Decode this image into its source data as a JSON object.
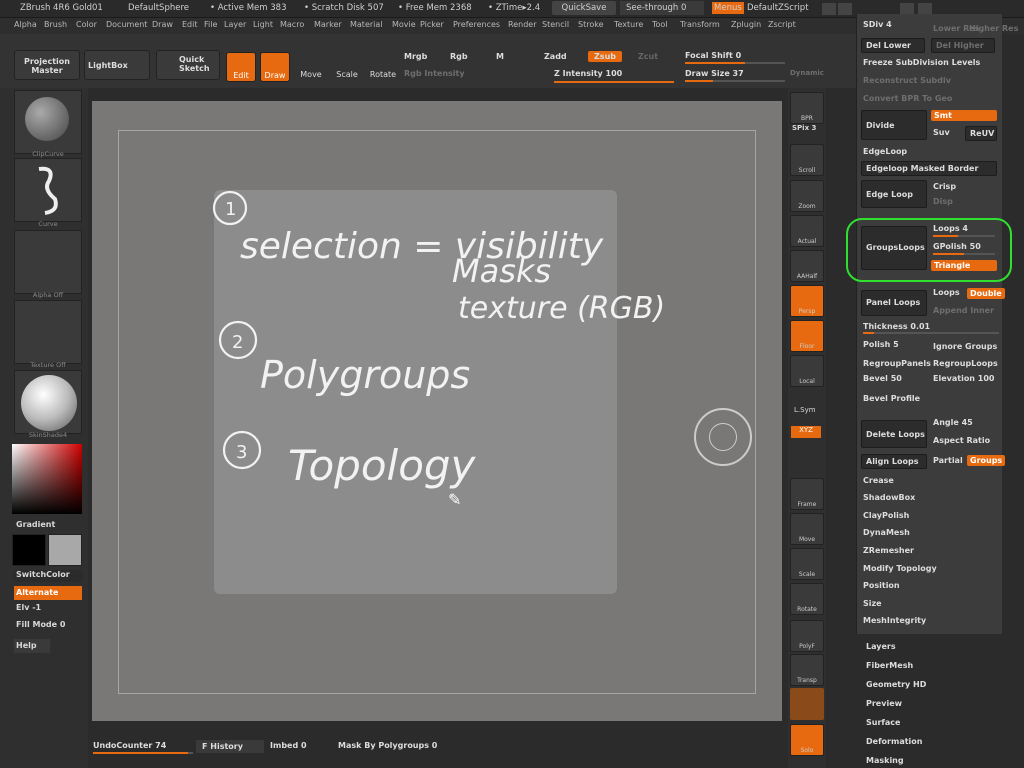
{
  "title_bar": {
    "app": "ZBrush 4R6 Gold01",
    "tool": "DefaultSphere",
    "active_mem": "• Active Mem 383",
    "scratch": "• Scratch Disk 507",
    "free_mem": "• Free Mem 2368",
    "ztime": "• ZTime▸2.4",
    "quicksave": "QuickSave",
    "see_through": "See-through  0",
    "menus": "Menus",
    "script": "DefaultZScript"
  },
  "menu": [
    "Alpha",
    "Brush",
    "Color",
    "Document",
    "Draw",
    "Edit",
    "File",
    "Layer",
    "Light",
    "Macro",
    "Marker",
    "Material",
    "Movie",
    "Picker",
    "Preferences",
    "Render",
    "Stencil",
    "Stroke",
    "Texture",
    "Tool",
    "Transform",
    "Zplugin",
    "Zscript"
  ],
  "toolbar": {
    "projection_master": "Projection Master",
    "lightbox": "LightBox",
    "quick_sketch": "Quick Sketch",
    "edit": "Edit",
    "draw": "Draw",
    "move": "Move",
    "scale": "Scale",
    "rotate": "Rotate",
    "mrgb": "Mrgb",
    "rgb": "Rgb",
    "m": "M",
    "rgb_intensity": "Rgb Intensity",
    "zadd": "Zadd",
    "zsub": "Zsub",
    "zcut": "Zcut",
    "z_intensity": "Z Intensity 100",
    "focal_shift": "Focal Shift 0",
    "draw_size": "Draw Size 37",
    "dynamic": "Dynamic"
  },
  "left_panel": {
    "brush_cap": "ClipCurve",
    "stroke_cap": "Curve",
    "alpha_cap": "Alpha Off",
    "texture_cap": "Texture Off",
    "material_cap": "SkinShade4",
    "gradient": "Gradient",
    "switch_color": "SwitchColor",
    "alternate": "Alternate",
    "elv": "Elv -1",
    "fill_mode": "Fill Mode 0",
    "help": "Help"
  },
  "canvas": {
    "handwriting": [
      "selection = visibility",
      "Masks",
      "texture (RGB)",
      "Polygroups",
      "Topology"
    ],
    "numbers": [
      "1",
      "2",
      "3"
    ]
  },
  "right_tools": [
    "BPR",
    "SPix 3",
    "Scroll",
    "Zoom",
    "Actual",
    "AAHalf",
    "Persp",
    "Floor",
    "Local",
    "L.Sym",
    "XYZ",
    "Frame",
    "Move",
    "Scale",
    "Rotate",
    "PolyF",
    "Transp",
    "Solo"
  ],
  "panel": {
    "sdiv": "SDiv 4",
    "lower_res": "Lower Res",
    "higher_res": "Higher Res",
    "del_lower": "Del Lower",
    "del_higher": "Del Higher",
    "freeze": "Freeze SubDivision Levels",
    "reconstruct": "Reconstruct Subdiv",
    "convert_bpr": "Convert BPR To Geo",
    "divide": "Divide",
    "smt": "Smt",
    "suv": "Suv",
    "reuv": "ReUV",
    "edgeloop_header": "EdgeLoop",
    "edgeloop_masked": "Edgeloop Masked Border",
    "edge_loop": "Edge Loop",
    "crisp": "Crisp",
    "disp": "Disp",
    "groupsloops": "GroupsLoops",
    "loops4": "Loops 4",
    "gpolish": "GPolish 50",
    "triangle": "Triangle",
    "panel_loops": "Panel Loops",
    "loops": "Loops",
    "double": "Double",
    "append_inner": "Append Inner",
    "thickness": "Thickness 0.01",
    "polish": "Polish 5",
    "ignore_groups": "Ignore Groups",
    "regroup_panels": "RegroupPanels",
    "regroup_loops": "RegroupLoops",
    "bevel": "Bevel 50",
    "elevation": "Elevation 100",
    "bevel_profile": "Bevel Profile",
    "delete_loops": "Delete Loops",
    "angle": "Angle 45",
    "aspect_ratio": "Aspect Ratio",
    "align_loops": "Align Loops",
    "partial": "Partial",
    "groups": "Groups",
    "crease": "Crease",
    "shadowbox": "ShadowBox",
    "claypolish": "ClayPolish",
    "dynamesh": "DynaMesh",
    "zremesher": "ZRemesher",
    "modify_topology": "Modify Topology",
    "position": "Position",
    "size": "Size",
    "meshintegrity": "MeshIntegrity"
  },
  "sub_menu": [
    "Layers",
    "FiberMesh",
    "Geometry HD",
    "Preview",
    "Surface",
    "Deformation",
    "Masking"
  ],
  "bottom": {
    "undo": "UndoCounter 74",
    "history": "F History",
    "imbed": "Imbed 0",
    "mask_polygroups": "Mask By Polygroups 0"
  },
  "colors": {
    "accent": "#e86a10",
    "highlight": "#2fe02f"
  }
}
